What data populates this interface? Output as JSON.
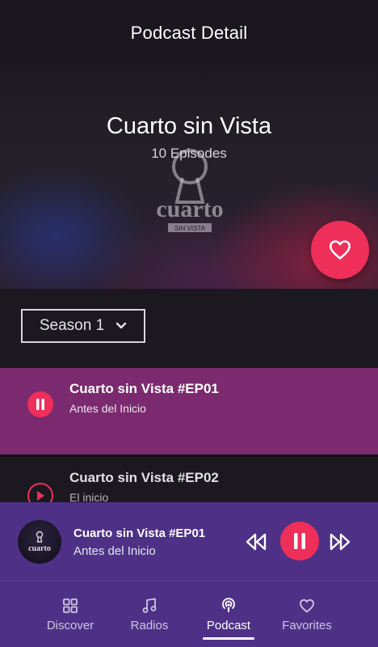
{
  "header": {
    "title": "Podcast Detail"
  },
  "podcast": {
    "title": "Cuarto sin Vista",
    "episodes_count": "10 Episodes",
    "cover_logo_text": "cuarto",
    "cover_logo_sub": "SIN VISTA"
  },
  "favorite_icon": "heart-outline-icon",
  "season_selector": {
    "selected": "Season 1"
  },
  "episodes": [
    {
      "title": "Cuarto sin Vista #EP01",
      "subtitle": "Antes del Inicio",
      "state": "playing"
    },
    {
      "title": "Cuarto sin Vista #EP02",
      "subtitle": "El inicio",
      "state": "paused"
    }
  ],
  "now_playing": {
    "title": "Cuarto sin Vista #EP01",
    "subtitle": "Antes del Inicio",
    "art_text": "cuarto"
  },
  "bottom_nav": [
    {
      "label": "Discover",
      "icon": "grid-icon",
      "active": false
    },
    {
      "label": "Radios",
      "icon": "music-note-icon",
      "active": false
    },
    {
      "label": "Podcast",
      "icon": "podcast-icon",
      "active": true
    },
    {
      "label": "Favorites",
      "icon": "heart-icon",
      "active": false
    }
  ],
  "colors": {
    "accent": "#ee2f5a",
    "active_episode_bg": "#7b2a6f",
    "player_bg": "#4e3187",
    "background": "#1b1820"
  }
}
